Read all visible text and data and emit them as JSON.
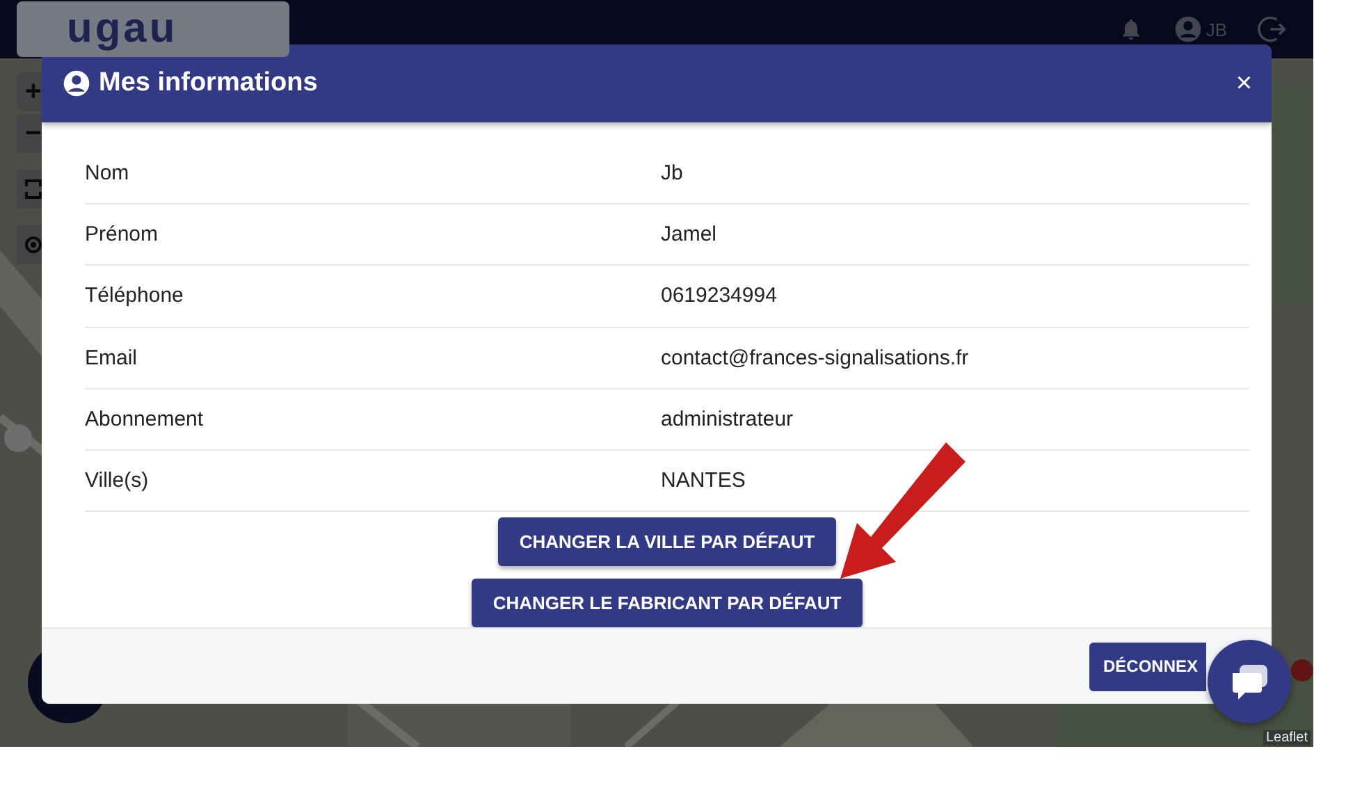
{
  "app_bar": {
    "logo": "ugau",
    "user": "JB"
  },
  "modal": {
    "title": "Mes informations",
    "close": "×",
    "rows": [
      {
        "label": "Nom",
        "value": "Jb"
      },
      {
        "label": "Prénom",
        "value": "Jamel"
      },
      {
        "label": "Téléphone",
        "value": "0619234994"
      },
      {
        "label": "Email",
        "value": "contact@frances-signalisations.fr"
      },
      {
        "label": "Abonnement",
        "value": "administrateur"
      },
      {
        "label": "Ville(s)",
        "value": "NANTES"
      }
    ],
    "actions": [
      "CHANGER LA VILLE PAR DÉFAUT",
      "CHANGER LE FABRICANT PAR DÉFAUT"
    ],
    "footer_button": "DÉCONNEX"
  },
  "map": {
    "zoom_in": "+",
    "zoom_out": "−",
    "attribution": "Leaflet"
  }
}
